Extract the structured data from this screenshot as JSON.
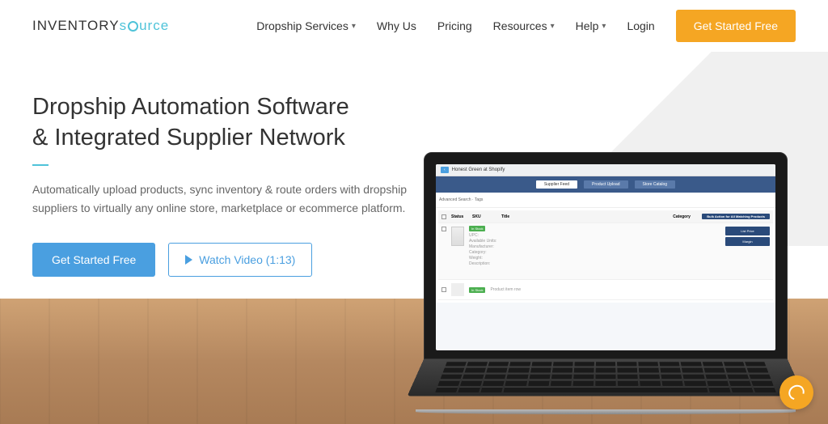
{
  "logo": {
    "first": "INVENTORY",
    "second": "s",
    "third": "urce"
  },
  "nav": {
    "items": [
      {
        "label": "Dropship Services",
        "has_chevron": true
      },
      {
        "label": "Why Us",
        "has_chevron": false
      },
      {
        "label": "Pricing",
        "has_chevron": false
      },
      {
        "label": "Resources",
        "has_chevron": true
      },
      {
        "label": "Help",
        "has_chevron": true
      },
      {
        "label": "Login",
        "has_chevron": false
      }
    ],
    "cta": "Get Started Free"
  },
  "hero": {
    "title_line1": "Dropship Automation Software",
    "title_line2": "& Integrated Supplier Network",
    "subtitle": "Automatically upload products, sync inventory & route orders with dropship suppliers to virtually any online store, marketplace or ecommerce platform.",
    "btn_primary": "Get Started Free",
    "btn_secondary": "Watch Video (1:13)"
  },
  "laptop": {
    "topbar_title": "Honest Green at Shopify",
    "tabs": [
      {
        "label": "Supplier Feed"
      },
      {
        "label": "Product Upload"
      },
      {
        "label": "Store Catalog"
      }
    ],
    "badge": "In Stock",
    "price_btn": "List Price",
    "margin_btn": "Margin"
  }
}
